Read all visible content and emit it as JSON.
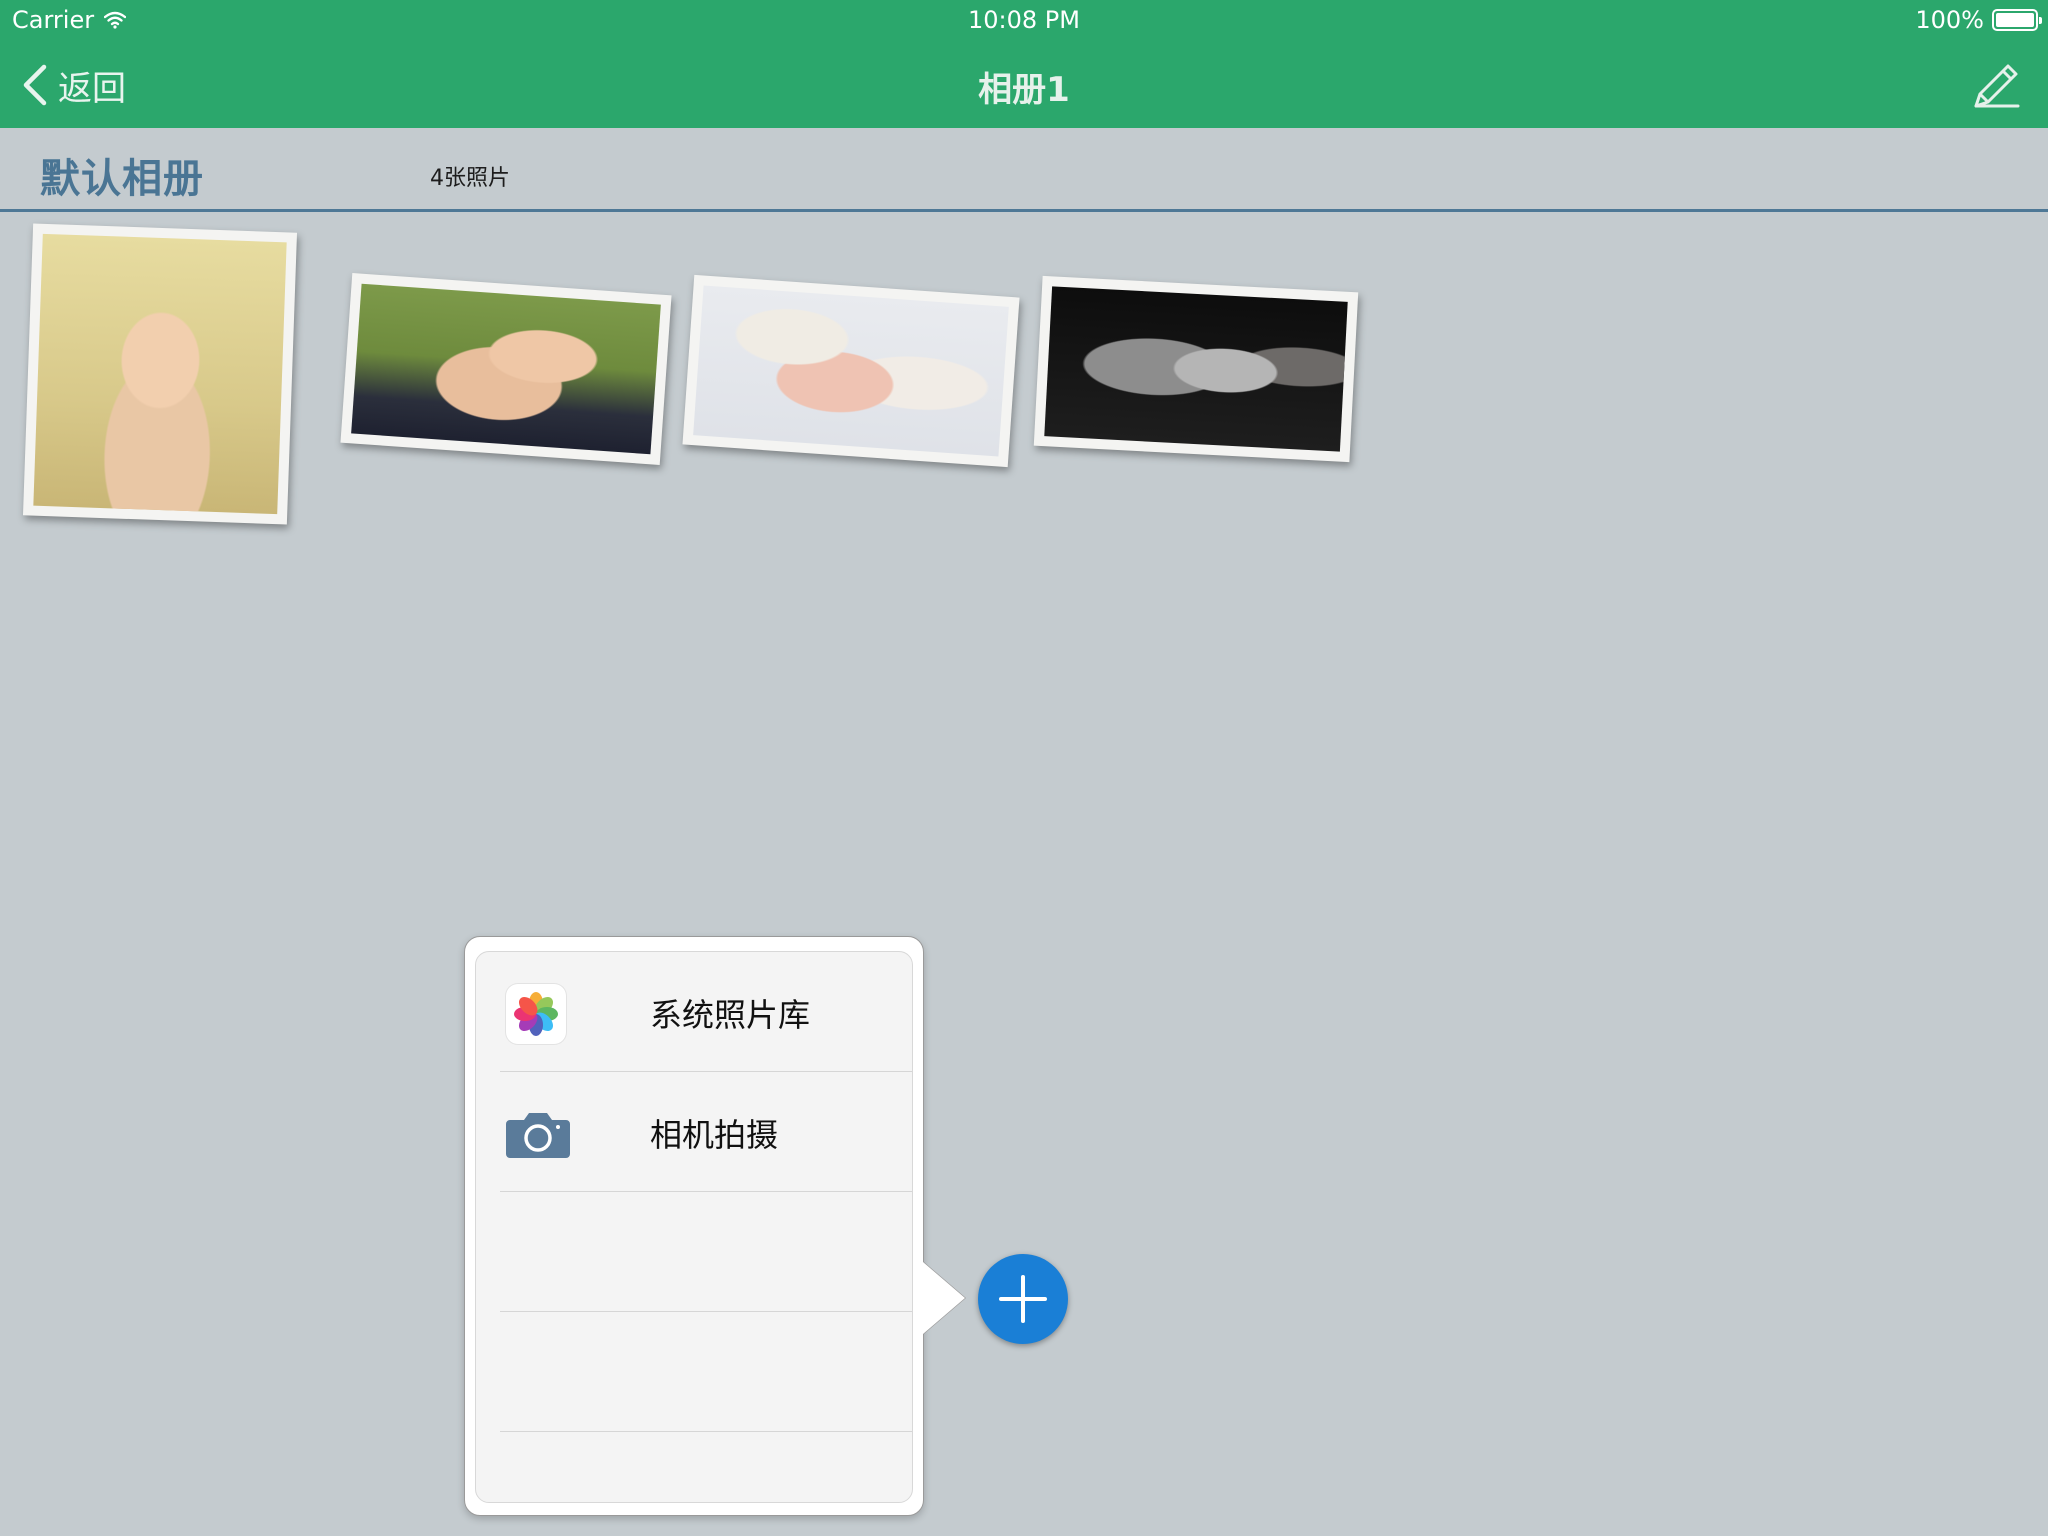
{
  "status_bar": {
    "carrier": "Carrier",
    "time": "10:08 PM",
    "battery": "100%",
    "battery_level": 1.0,
    "wifi_icon": "wifi-icon",
    "battery_icon": "battery-icon"
  },
  "nav": {
    "back_label": "返回",
    "title": "相册1",
    "edit_icon": "pencil-icon",
    "back_icon": "chevron-left-icon"
  },
  "album": {
    "name": "默认相册",
    "photo_count": "4张照片"
  },
  "photos": [
    {
      "subject": "newborn-with-headband"
    },
    {
      "subject": "newborn-green-hat"
    },
    {
      "subject": "newborn-white-knit-hat"
    },
    {
      "subject": "newborn-black-and-white"
    }
  ],
  "add_menu": {
    "items": [
      {
        "label": "系统照片库",
        "icon": "photos-app-icon"
      },
      {
        "label": "相机拍摄",
        "icon": "camera-icon"
      },
      {
        "label": "",
        "icon": ""
      },
      {
        "label": "",
        "icon": ""
      }
    ]
  },
  "add_button": {
    "icon": "plus-icon"
  },
  "colors": {
    "nav_bar": "#2ba76c",
    "background": "#c4cbcf",
    "album_title": "#4a7594",
    "add_button": "#1a7fd6",
    "camera_icon": "#5a7b9a"
  }
}
